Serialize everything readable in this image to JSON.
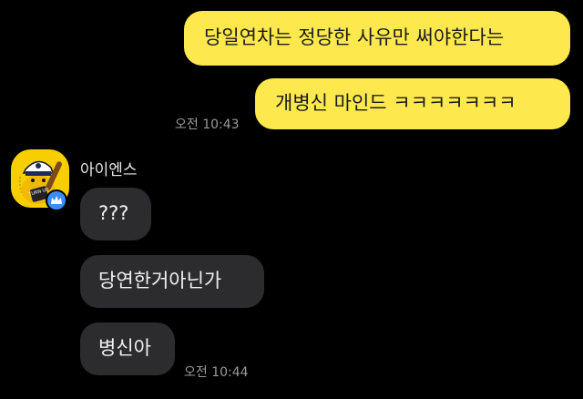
{
  "chat": {
    "messages": [
      {
        "sender": "me",
        "text": "당일연차는 정당한 사유만 써야한다는"
      },
      {
        "sender": "me",
        "text": "개병신 마인드 ㅋㅋㅋㅋㅋㅋㅋ"
      },
      {
        "sender": "other",
        "text": "???"
      },
      {
        "sender": "other",
        "text": "당연한거아닌가"
      },
      {
        "sender": "other",
        "text": "병신아"
      }
    ],
    "my_timestamp": "오전 10:43",
    "other_timestamp": "오전 10:44",
    "other_name": "아이엔스",
    "avatar_text": "TURN UP",
    "colors": {
      "background": "#000000",
      "my_bubble": "#fde94e",
      "other_bubble": "#2c2c2e",
      "avatar_bg": "#f7cf00",
      "badge": "#3b8cf5"
    },
    "icons": {
      "avatar": "cartoon-character-avatar",
      "badge": "crown-icon"
    }
  }
}
